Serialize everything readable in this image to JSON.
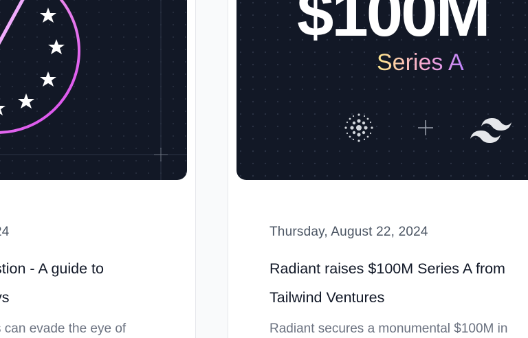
{
  "left_card": {
    "date": "24",
    "title_line1": "stion - A guide to",
    "title_line2": "ys",
    "excerpt": "s can evade the eye of"
  },
  "right_card": {
    "image_amount": "$100M",
    "image_series": "Series A",
    "date": "Thursday, August 22, 2024",
    "title_line1": "Radiant raises $100M Series A from",
    "title_line2": "Tailwind Ventures",
    "excerpt": "Radiant secures a monumental $100M in"
  },
  "colors": {
    "card_background": "#121826",
    "accent_pink": "#f0abfc",
    "accent_gradient_start": "#fde68a",
    "accent_gradient_end": "#c084fc"
  },
  "icons": {
    "eu_stars": "eu-stars-icon",
    "dot_logo": "radiant-dots-logo-icon",
    "plus": "plus-icon",
    "tailwind": "tailwind-logo-icon"
  }
}
